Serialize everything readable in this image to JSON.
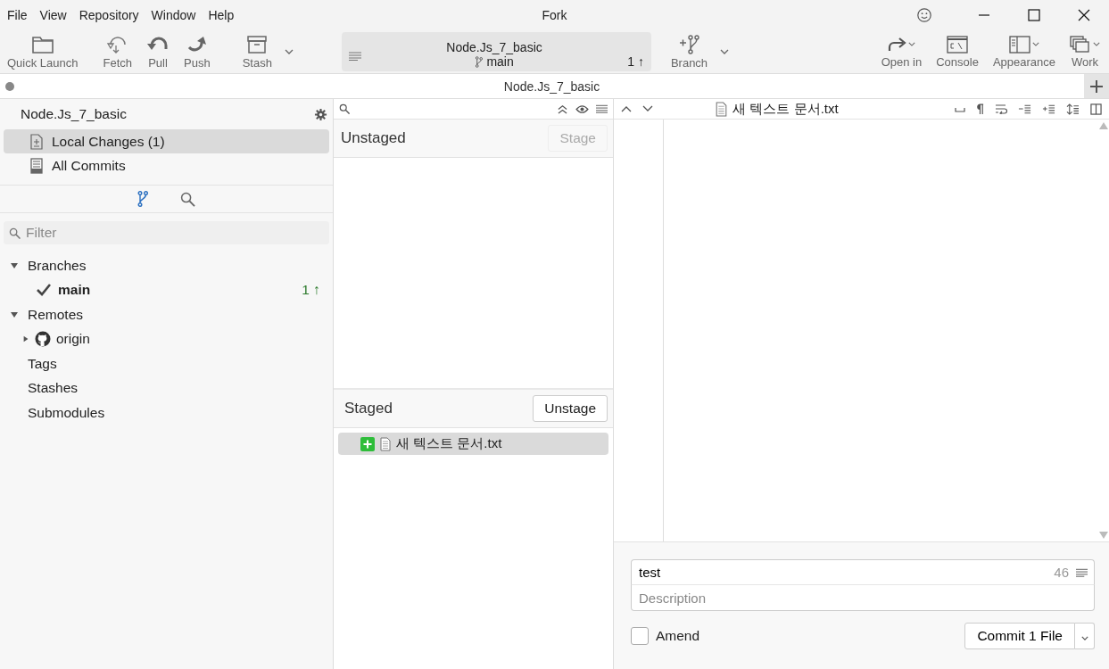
{
  "window": {
    "title": "Fork"
  },
  "menu": [
    "File",
    "View",
    "Repository",
    "Window",
    "Help"
  ],
  "toolbar": {
    "left": [
      {
        "label": "Quick Launch",
        "kind": "folder",
        "dropdown": false
      },
      {
        "label": "Fetch",
        "kind": "fetch",
        "dropdown": false
      },
      {
        "label": "Pull",
        "kind": "pull",
        "dropdown": false
      },
      {
        "label": "Push",
        "kind": "push",
        "dropdown": false
      },
      {
        "label": "Stash",
        "kind": "stash",
        "dropdown": true
      }
    ],
    "repo": {
      "name": "Node.Js_7_basic",
      "branch": "main",
      "ahead": "1 ↑"
    },
    "middle": [
      {
        "label": "Branch",
        "kind": "branch",
        "dropdown": true
      }
    ],
    "right": [
      {
        "label": "Open in",
        "kind": "open",
        "dropdown": true
      },
      {
        "label": "Console",
        "kind": "console",
        "dropdown": false
      },
      {
        "label": "Appearance",
        "kind": "appearance",
        "dropdown": true
      },
      {
        "label": "Work",
        "kind": "work",
        "dropdown": true
      }
    ]
  },
  "tabs": [
    {
      "label": "Node.Js_7_basic",
      "selected": true
    }
  ],
  "sidebar": {
    "repo_title": "Node.Js_7_basic",
    "nav": [
      {
        "label": "Local Changes (1)",
        "kind": "local",
        "selected": true
      },
      {
        "label": "All Commits",
        "kind": "commits",
        "selected": false
      }
    ],
    "modes": [
      {
        "kind": "branches",
        "selected": true
      },
      {
        "kind": "search",
        "selected": false
      }
    ],
    "filter": {
      "placeholder": "Filter"
    },
    "tree": [
      {
        "label": "Branches",
        "expanded": true,
        "children": [
          {
            "label": "main",
            "current": true,
            "count": "1 ↑"
          }
        ]
      },
      {
        "label": "Remotes",
        "expanded": true,
        "children": [
          {
            "label": "origin",
            "kind": "github",
            "expanded": false
          }
        ]
      },
      {
        "label": "Tags"
      },
      {
        "label": "Stashes"
      },
      {
        "label": "Submodules"
      }
    ]
  },
  "changes": {
    "unstaged": {
      "title": "Unstaged",
      "button": {
        "label": "Stage",
        "disabled": true
      }
    },
    "staged": {
      "title": "Staged",
      "button": {
        "label": "Unstage",
        "disabled": false
      },
      "files": [
        {
          "name": "새 텍스트 문서.txt",
          "kind": "added",
          "selected": true
        }
      ]
    }
  },
  "diff": {
    "file": "새 텍스트 문서.txt"
  },
  "commit": {
    "summary": "test",
    "counter": "46",
    "description": {
      "placeholder": "Description"
    },
    "amend": {
      "label": "Amend",
      "checked": false
    },
    "button": "Commit 1 File"
  }
}
